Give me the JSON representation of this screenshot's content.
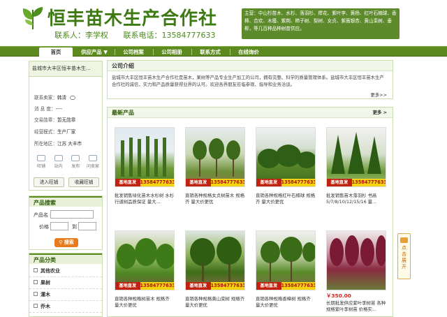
{
  "header": {
    "title": "恒丰苗木生产合作社",
    "contact_person": "联系人：李学权",
    "contact_phone": "联系电话：13584777633",
    "main_products": "主营：中山杉苗木、水杉、落羽杉、榉花、紫叶李、黄杨、红叶石楠球、香樟、合欢、木槿、紫荆、柿子树、梨树、女贞、紫薇银杏、黄山栾树、垂柳，等几百种品种树苗供应。"
  },
  "nav": {
    "items": [
      "首页",
      "供应产品 ▼",
      "公司档案",
      "公司相册",
      "联系方式",
      "在线询价"
    ],
    "active_index": 0
  },
  "profile": {
    "company": "盐城市大丰区恒丰苗木生...",
    "contact_label": "联系卖家：",
    "contact_value": "韩清",
    "message_label": "消 息 度：",
    "message_value": "----",
    "cert_label": "交易勋章：",
    "cert_value": "暂无勋章",
    "mode_label": "经营模式：",
    "mode_value": "生产厂家",
    "location_label": "所在地区：",
    "location_value": "江苏 大丰市",
    "icons": [
      "旺铺",
      "站内",
      "发布",
      "问卖家"
    ],
    "btn_enter": "进入旺铺",
    "btn_fav": "收藏旺铺"
  },
  "search": {
    "title": "产品搜索",
    "name_label": "产品名",
    "price_label": "价格",
    "to_label": "到",
    "button": "搜索"
  },
  "categories": {
    "title": "产品分类",
    "items": [
      "其他农业",
      "果树",
      "灌木",
      "乔木"
    ]
  },
  "intro": {
    "title": "公司介绍",
    "text": "盐城市大丰区恒丰苗木生产合作社是苗木，果树等产品专业生产加工的公司，拥有完整、科学的质量管理体系。盐城市大丰区恒丰苗木生产合作社的诚信，实力和产品质量获得业界的认可。欢迎各界朋友莅临参观、指导和业务洽谈。",
    "more": "更多>>"
  },
  "products": {
    "title": "最新产品",
    "more": "更多 >",
    "tag_label": "基地直发",
    "tag_phone": "13584777633",
    "items": [
      {
        "desc": "批发销售绿化苗木水杉树 水杉行道树品质保证 量大...",
        "price": ""
      },
      {
        "desc": "直销各种规格女贞树苗木 规格齐 量大价更优",
        "price": ""
      },
      {
        "desc": "直销各种规格红叶石楠球 规格齐 量大价更优",
        "price": ""
      },
      {
        "desc": "批发销售苗木落羽杉 书高5/7/8/10/12/15/16 量...",
        "price": ""
      },
      {
        "desc": "直销各种规格树苗木 规格齐 量大价更优",
        "price": ""
      },
      {
        "desc": "直销各种规格黄山栾树 规格齐 量大价更优",
        "price": ""
      },
      {
        "desc": "直销各种规格香樟树 规格齐 量大价更优",
        "price": ""
      },
      {
        "desc": "长期批发供应紫叶李树苗 各种规格紫叶李树苗 价格实...",
        "price": "￥350.00"
      }
    ]
  },
  "float_tab": {
    "text": "点击展开"
  },
  "colors": {
    "brand_green": "#5d8a1e",
    "title_green": "#3e7a12",
    "tag_red": "#c0220f",
    "tag_yellow": "#f3d312",
    "price_red": "#d8261a",
    "button_orange": "#e87b1c"
  }
}
